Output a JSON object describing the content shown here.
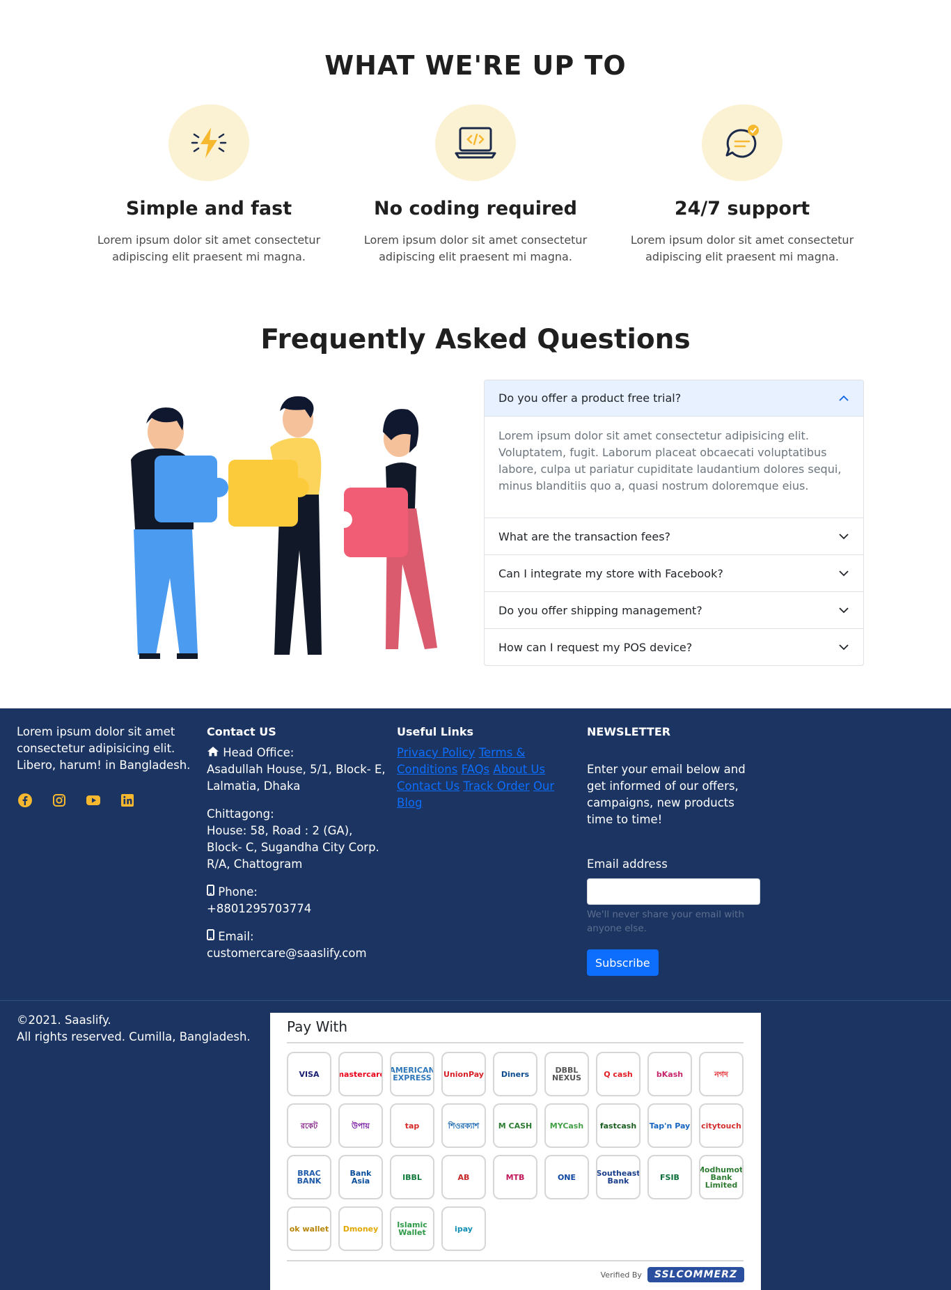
{
  "upto": {
    "title": "WHAT WE'RE UP TO",
    "features": [
      {
        "icon": "lightning-icon",
        "title": "Simple and fast",
        "text": "Lorem ipsum dolor sit amet consectetur adipiscing elit praesent mi magna."
      },
      {
        "icon": "laptop-code-icon",
        "title": "No coding required",
        "text": "Lorem ipsum dolor sit amet consectetur adipiscing elit praesent mi magna."
      },
      {
        "icon": "chat-support-icon",
        "title": "24/7 support",
        "text": "Lorem ipsum dolor sit amet consectetur adipiscing elit praesent mi magna."
      }
    ]
  },
  "faq": {
    "title": "Frequently Asked Questions",
    "items": [
      {
        "question": "Do you offer a product free trial?",
        "answer": "Lorem ipsum dolor sit amet consectetur adipisicing elit. Voluptatem, fugit. Laborum placeat obcaecati voluptatibus labore, culpa ut pariatur cupiditate laudantium dolores sequi, minus blanditiis quo a, quasi nostrum doloremque eius.",
        "open": true
      },
      {
        "question": "What are the transaction fees?",
        "open": false
      },
      {
        "question": "Can I integrate my store with Facebook?",
        "open": false
      },
      {
        "question": "Do you offer shipping management?",
        "open": false
      },
      {
        "question": "How can I request my POS device?",
        "open": false
      }
    ]
  },
  "footer": {
    "about": "Lorem ipsum dolor sit amet consectetur adipisicing elit. Libero, harum! in Bangladesh.",
    "socials": [
      "facebook-icon",
      "instagram-icon",
      "youtube-icon",
      "linkedin-icon"
    ],
    "contact": {
      "heading": "Contact US",
      "head_office_label": "Head Office:",
      "head_office": "Asadullah House, 5/1, Block- E, Lalmatia, Dhaka",
      "chittagong_label": "Chittagong:",
      "chittagong": "House: 58, Road : 2 (GA), Block- C, Sugandha City Corp. R/A, Chattogram",
      "phone_label": "Phone:",
      "phone": "+8801295703774",
      "email_label": "Email:",
      "email": "customercare@saaslify.com"
    },
    "links": {
      "heading": "Useful Links",
      "items": [
        "Privacy Policy",
        "Terms & Conditions",
        "FAQs",
        "About Us",
        "Contact Us",
        "Track Order",
        "Our Blog"
      ]
    },
    "newsletter": {
      "heading": "NEWSLETTER",
      "description": "Enter your email below and get informed of our offers, campaigns, new products time to time!",
      "email_label": "Email address",
      "email_value": "",
      "help": "We'll never share your email with anyone else.",
      "button": "Subscribe"
    },
    "copyright_line1": "©2021. Saaslify.",
    "copyright_line2": "All rights reserved. Cumilla, Bangladesh.",
    "paywith": {
      "title": "Pay With",
      "logos": [
        "VISA",
        "mastercard",
        "AMERICAN EXPRESS",
        "UnionPay",
        "Diners",
        "DBBL NEXUS",
        "Q cash",
        "bKash",
        "নগদ",
        "রকেট",
        "উপায়",
        "tap",
        "শিওরক্যাশ",
        "M CASH",
        "MYCash",
        "fastcash",
        "Tap'n Pay",
        "citytouch",
        "BRAC BANK",
        "Bank Asia",
        "IBBL",
        "AB",
        "MTB",
        "ONE",
        "Southeast Bank",
        "FSIB",
        "Modhumoti Bank Limited",
        "ok wallet",
        "Dmoney",
        "Islamic Wallet",
        "ipay"
      ],
      "verified_by": "Verified By",
      "ssl": "SSLCOMMERZ"
    }
  }
}
